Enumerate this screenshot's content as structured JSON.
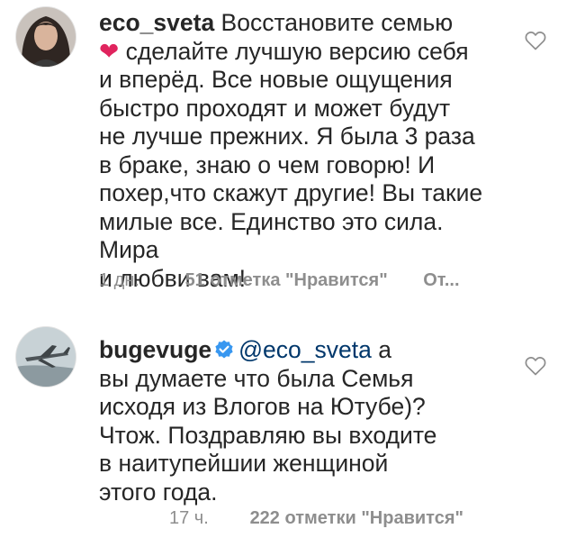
{
  "comments": [
    {
      "username": "eco_sveta",
      "verified": false,
      "mention": "",
      "text_lead": " Восстановите семью",
      "emoji": "❤",
      "text_lines": [
        " сделайте лучшую версию себя",
        "и вперёд. Все новые ощущения",
        "быстро проходят и может будут",
        "не лучше прежних. Я была 3 раза",
        "в браке, знаю о чем говорю! И",
        "похер,что скажут другие! Вы такие",
        "милые все. Единство это сила. Мира",
        "и любви вам!"
      ],
      "time": "1 дн.",
      "likes": "51 отметка \"Нравится\"",
      "reply": "От..."
    },
    {
      "username": "bugevuge",
      "verified": true,
      "mention": "@eco_sveta",
      "text_lead": " а",
      "text_lines": [
        "вы думаете что была Семья",
        "исходя из Влогов на Ютубе)?",
        "Чтож. Поздравляю вы входите",
        "в наитупейшии женщиной",
        "этого года."
      ],
      "time": "17 ч.",
      "likes": "222 отметки \"Нравится\""
    }
  ],
  "icons": {
    "like": "heart-outline-icon",
    "verified": "verified-badge-icon"
  },
  "colors": {
    "text": "#262626",
    "meta": "#8e8e8e",
    "mention": "#00376b",
    "verified": "#3897f0",
    "heart": "#e0245e"
  }
}
